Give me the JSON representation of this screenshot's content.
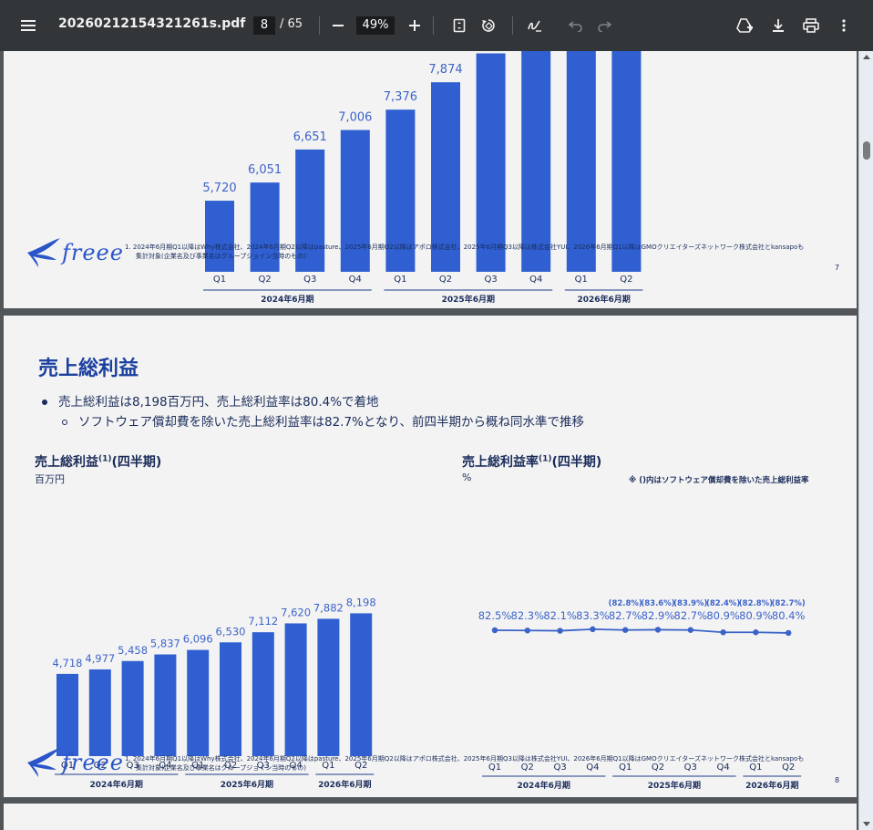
{
  "toolbar": {
    "title": "20260212154321261s.pdf",
    "page_current": "8",
    "page_separator": "/",
    "page_total": "65",
    "zoom": "49%"
  },
  "icons": {
    "menu": "menu-icon",
    "zoom_out": "minus-icon",
    "zoom_in": "plus-icon",
    "fit": "fit-page-icon",
    "rotate": "rotate-icon",
    "annotate": "pen-icon",
    "undo": "undo-icon",
    "redo": "redo-icon",
    "drive": "drive-add-icon",
    "download": "download-icon",
    "print": "print-icon",
    "more": "more-vert-icon"
  },
  "colors": {
    "bar": "#2f5fd0",
    "toolbar": "#323639",
    "line": "#3b63c8",
    "brand": "#2a55c9"
  },
  "page7": {
    "logo": "freee",
    "footnote_line1": "1. 2024年6月期Q1以降はWhy株式会社、2024年6月期Q2以降はpasture、2025年6月期Q2以降はアポロ株式会社、2025年6月期Q3以降は株式会社YUI、2026年6月期Q1以降はGMOクリエイターズネットワーク株式会社とkansapoも",
    "footnote_line2": "集計対象(企業名及び事業名はグループジョイン当時のもの)",
    "page_number": "7"
  },
  "page8": {
    "title": "売上総利益",
    "bullet1": "売上総利益は8,198百万円、売上総利益率は80.4%で着地",
    "bullet2": "ソフトウェア償却費を除いた売上総利益率は82.7%となり、前四半期から概ね同水準で推移",
    "left_heading": "売上総利益",
    "left_heading_sup": "(1)",
    "left_heading_suffix": "(四半期)",
    "left_unit": "百万円",
    "right_heading": "売上総利益率",
    "right_heading_sup": "(1)",
    "right_heading_suffix": "(四半期)",
    "right_unit": "%",
    "right_note": "※ ()内はソフトウェア償却費を除いた売上総利益率",
    "logo": "freee",
    "footnote_line1": "1. 2024年6月期Q1以降はWhy株式会社、2024年6月期Q2以降はpasture、2025年6月期Q2以降はアポロ株式会社、2025年6月期Q3以降は株式会社YUI、2026年6月期Q1以降はGMOクリエイターズネットワーク株式会社とkansapoも",
    "footnote_line2": "集計対象(企業名及び事業名はグループジョイン当時のもの)",
    "page_number": "8"
  },
  "chart_data": [
    {
      "type": "bar",
      "categories": [
        "Q1",
        "Q2",
        "Q3",
        "Q4",
        "Q1",
        "Q2",
        "Q3",
        "Q4",
        "Q1",
        "Q2"
      ],
      "groups": [
        {
          "label": "2024年6月期",
          "span": 4
        },
        {
          "label": "2025年6月期",
          "span": 4
        },
        {
          "label": "2026年6月期",
          "span": 2
        }
      ],
      "values": [
        5720,
        6051,
        6651,
        7006,
        7376,
        7874,
        null,
        null,
        null,
        null
      ],
      "labels": [
        "5,720",
        "6,051",
        "6,651",
        "7,006",
        "7,376",
        "7,874",
        "",
        "",
        "",
        ""
      ],
      "note": "partially visible: top cropped"
    },
    {
      "type": "bar",
      "categories": [
        "Q1",
        "Q2",
        "Q3",
        "Q4",
        "Q1",
        "Q2",
        "Q3",
        "Q4",
        "Q1",
        "Q2"
      ],
      "groups": [
        {
          "label": "2024年6月期",
          "span": 4
        },
        {
          "label": "2025年6月期",
          "span": 4
        },
        {
          "label": "2026年6月期",
          "span": 2
        }
      ],
      "values": [
        4718,
        4977,
        5458,
        5837,
        6096,
        6530,
        7112,
        7620,
        7882,
        8198
      ],
      "labels": [
        "4,718",
        "4,977",
        "5,458",
        "5,837",
        "6,096",
        "6,530",
        "7,112",
        "7,620",
        "7,882",
        "8,198"
      ]
    },
    {
      "type": "line",
      "categories": [
        "Q1",
        "Q2",
        "Q3",
        "Q4",
        "Q1",
        "Q2",
        "Q3",
        "Q4",
        "Q1",
        "Q2"
      ],
      "groups": [
        {
          "label": "2024年6月期",
          "span": 4
        },
        {
          "label": "2025年6月期",
          "span": 4
        },
        {
          "label": "2026年6月期",
          "span": 2
        }
      ],
      "values": [
        82.5,
        82.3,
        82.1,
        83.3,
        82.7,
        82.9,
        82.7,
        80.9,
        80.9,
        80.4
      ],
      "labels": [
        "82.5%",
        "82.3%",
        "82.1%",
        "83.3%",
        "82.7%",
        "82.9%",
        "82.7%",
        "80.9%",
        "80.9%",
        "80.4%"
      ],
      "excl_labels": [
        "",
        "",
        "",
        "",
        "(82.8%)",
        "(83.6%)",
        "(83.9%)",
        "(82.4%)",
        "(82.8%)",
        "(82.7%)"
      ]
    }
  ]
}
